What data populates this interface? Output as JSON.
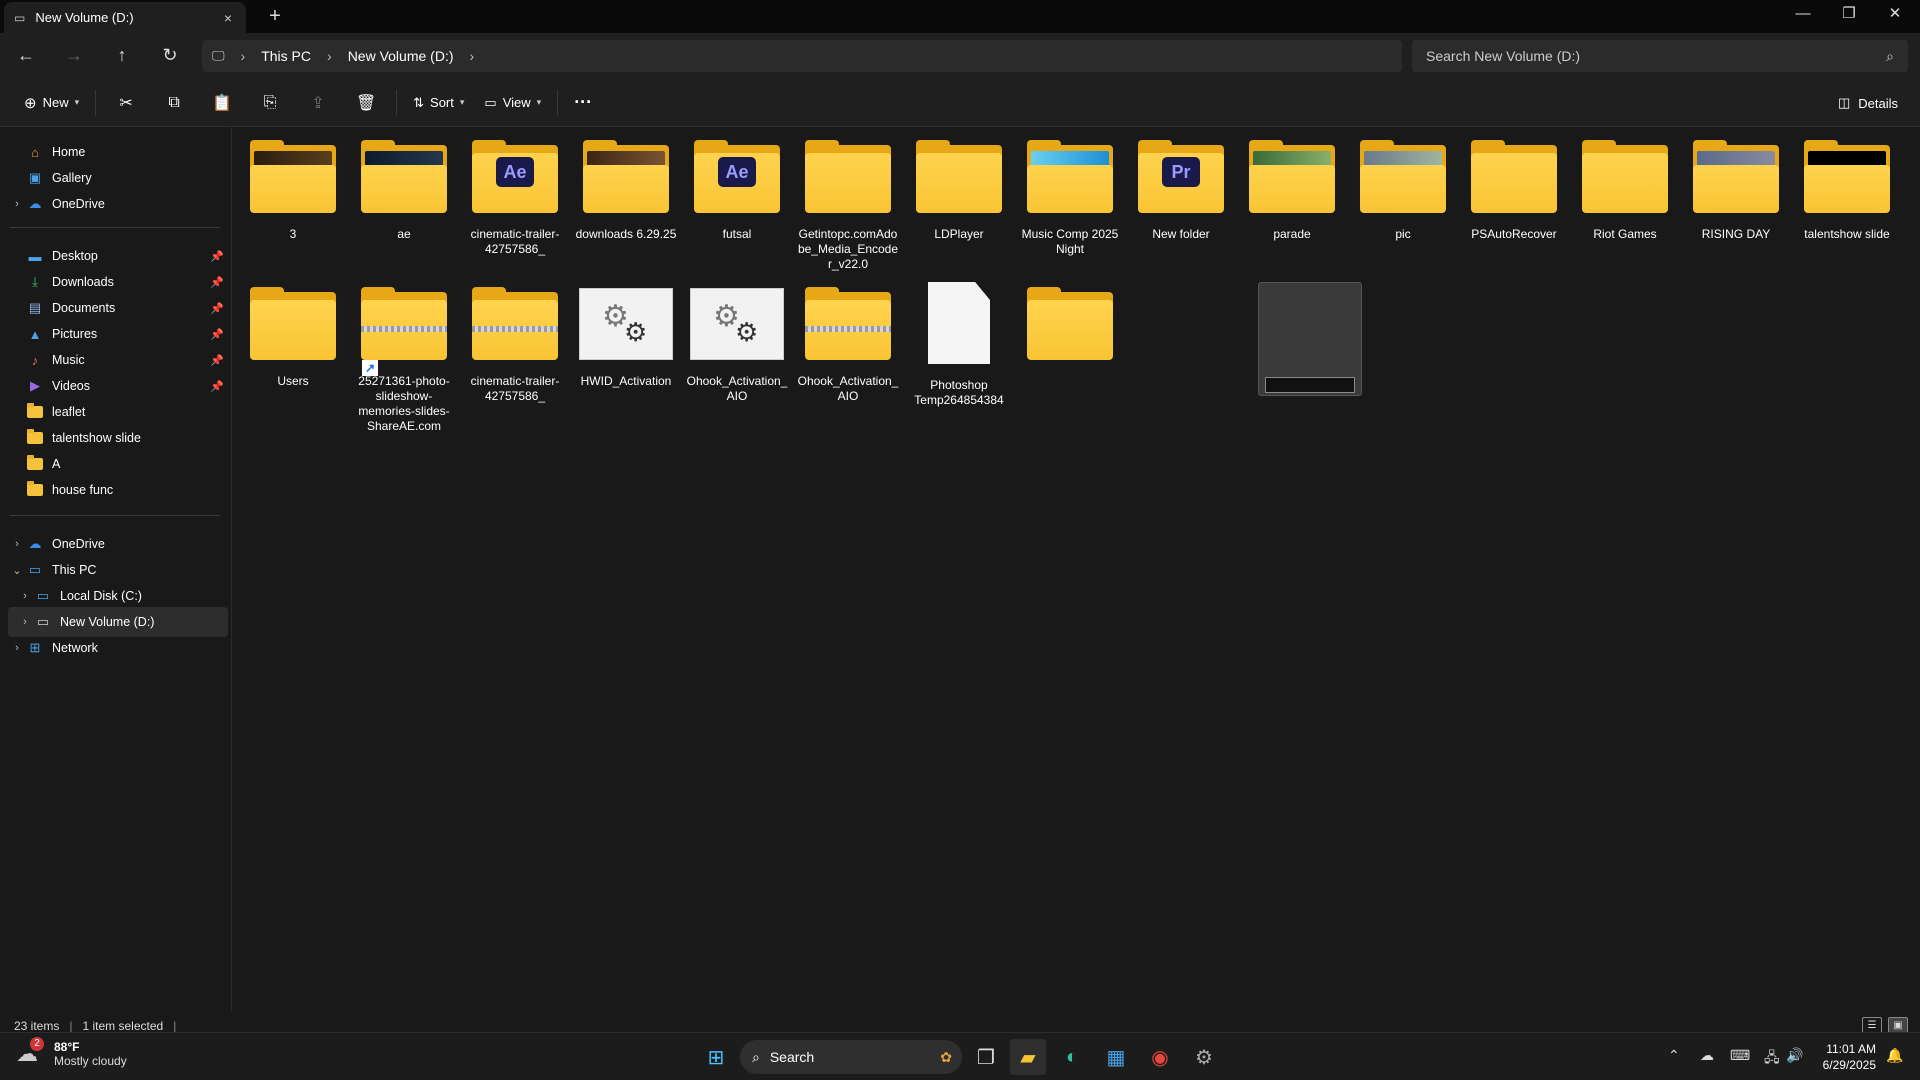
{
  "window": {
    "tab_title": "New Volume (D:)",
    "tab_close": "×",
    "new_tab": "+",
    "minimize": "—",
    "maximize": "❐",
    "close": "✕"
  },
  "address": {
    "breadcrumbs": [
      "This PC",
      "New Volume (D:)"
    ],
    "search_placeholder": "Search New Volume (D:)"
  },
  "commands": {
    "new_label": "New",
    "sort_label": "Sort",
    "view_label": "View",
    "more_label": "···",
    "details_label": "Details"
  },
  "sidebar": {
    "top": [
      {
        "label": "Home",
        "icon": "home-icon"
      },
      {
        "label": "Gallery",
        "icon": "gallery-icon"
      },
      {
        "label": "OneDrive",
        "icon": "cloud-icon"
      }
    ],
    "pinned": [
      {
        "label": "Desktop",
        "icon": "desktop-icon"
      },
      {
        "label": "Downloads",
        "icon": "download-icon"
      },
      {
        "label": "Documents",
        "icon": "documents-icon"
      },
      {
        "label": "Pictures",
        "icon": "pictures-icon"
      },
      {
        "label": "Music",
        "icon": "music-icon"
      },
      {
        "label": "Videos",
        "icon": "videos-icon"
      },
      {
        "label": "leaflet",
        "icon": "folder-icon"
      },
      {
        "label": "talentshow slide",
        "icon": "folder-icon"
      },
      {
        "label": "A",
        "icon": "folder-icon"
      },
      {
        "label": "house func",
        "icon": "folder-icon"
      }
    ],
    "tree": [
      {
        "label": "OneDrive",
        "icon": "cloud-icon"
      },
      {
        "label": "This PC",
        "icon": "pc-icon"
      },
      {
        "label": "Local Disk (C:)",
        "icon": "drive-icon"
      },
      {
        "label": "New Volume (D:)",
        "icon": "drive-icon"
      },
      {
        "label": "Network",
        "icon": "network-icon"
      }
    ]
  },
  "files": {
    "row1": [
      {
        "name": "3"
      },
      {
        "name": "ae"
      },
      {
        "name": "cinematic-trailer-42757586_"
      },
      {
        "name": "downloads 6.29.25"
      },
      {
        "name": "futsal"
      },
      {
        "name": "Getintopc.comAdobe_Media_Encoder_v22.0"
      },
      {
        "name": "LDPlayer"
      },
      {
        "name": "Music Comp 2025 Night"
      },
      {
        "name": "New folder"
      },
      {
        "name": "parade"
      },
      {
        "name": "pic"
      },
      {
        "name": "PSAutoRecover"
      },
      {
        "name": "Riot Games"
      },
      {
        "name": "RISING DAY"
      },
      {
        "name": "talentshow slide"
      }
    ],
    "row2": [
      {
        "name": "Users"
      },
      {
        "name": "25271361-photo-slideshow-memories-slides-ShareAE.com"
      },
      {
        "name": "cinematic-trailer-42757586_"
      },
      {
        "name": "HWID_Activation"
      },
      {
        "name": "Ohook_Activation_AIO"
      },
      {
        "name": "Ohook_Activation_AIO"
      },
      {
        "name": "Photoshop Temp264854384"
      },
      {
        "name": ""
      }
    ],
    "badges": {
      "ae": "Ae",
      "pr": "Pr"
    }
  },
  "status": {
    "count": "23 items",
    "selected": "1 item selected"
  },
  "taskbar": {
    "weather_temp": "88°F",
    "weather_desc": "Mostly cloudy",
    "weather_badge": "2",
    "search_label": "Search",
    "time": "11:01 AM",
    "date": "6/29/2025"
  },
  "colors": {
    "accent": "#4cc2ff",
    "folder": "#f8c434",
    "background": "#191919"
  }
}
